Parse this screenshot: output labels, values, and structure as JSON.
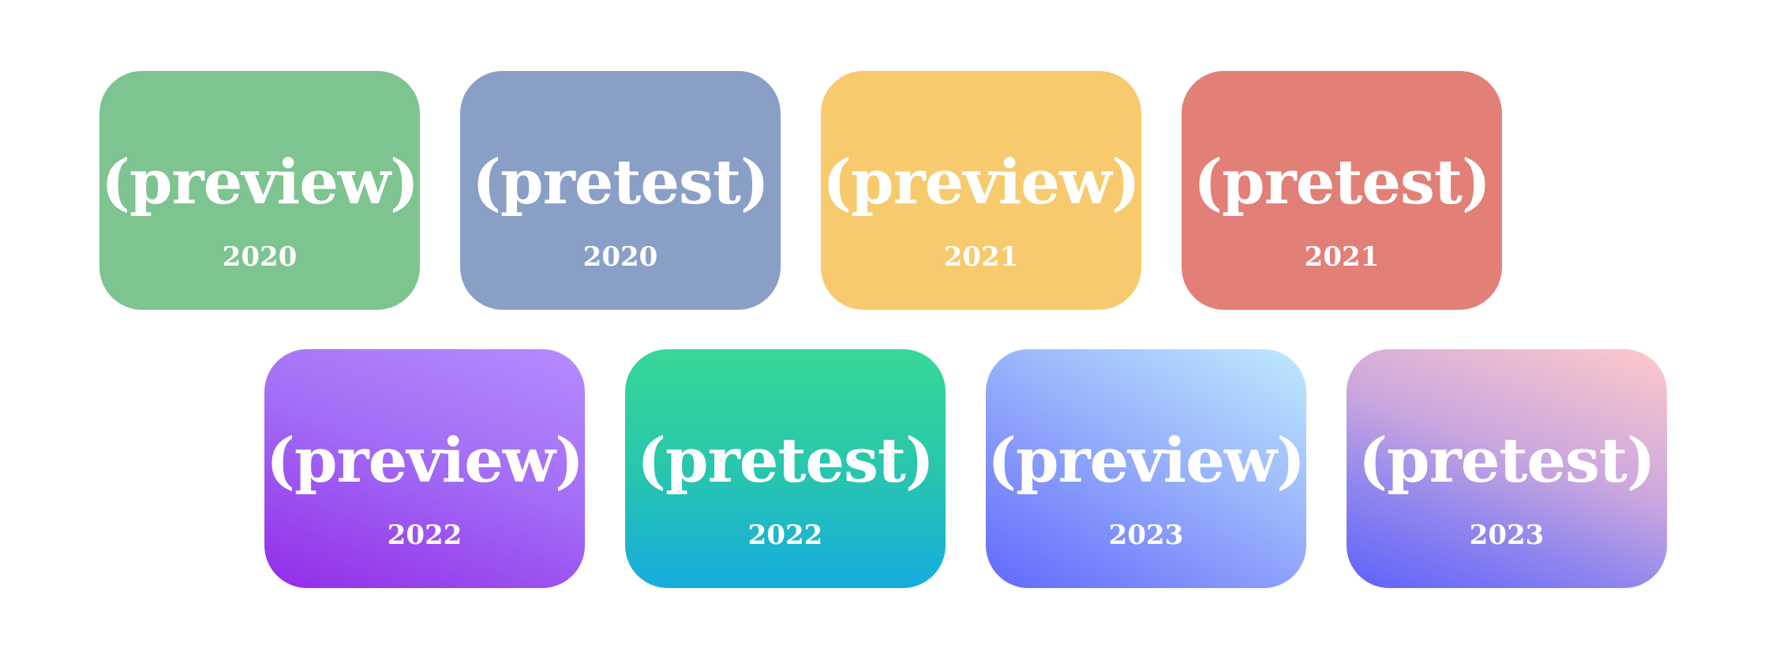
{
  "cards": [
    {
      "label": "(preview)",
      "year": "2020"
    },
    {
      "label": "(pretest)",
      "year": "2020"
    },
    {
      "label": "(preview)",
      "year": "2021"
    },
    {
      "label": "(pretest)",
      "year": "2021"
    },
    {
      "label": "(preview)",
      "year": "2022"
    },
    {
      "label": "(pretest)",
      "year": "2022"
    },
    {
      "label": "(preview)",
      "year": "2023"
    },
    {
      "label": "(pretest)",
      "year": "2023"
    }
  ],
  "colors": {
    "card_1": "#7dc490",
    "card_2": "#8a9fc6",
    "card_3": "#f6ca6d",
    "card_4": "#e27f77",
    "card_5_gradient": [
      "#b58bff",
      "#922de8"
    ],
    "card_6_gradient": [
      "#37d896",
      "#16acdf"
    ],
    "card_7_gradient": [
      "#bfeafe",
      "#6268fc"
    ],
    "card_8_gradient": [
      "#ffc9ca",
      "#5e62fb"
    ],
    "text": "#ffffff",
    "background": "#ffffff"
  }
}
